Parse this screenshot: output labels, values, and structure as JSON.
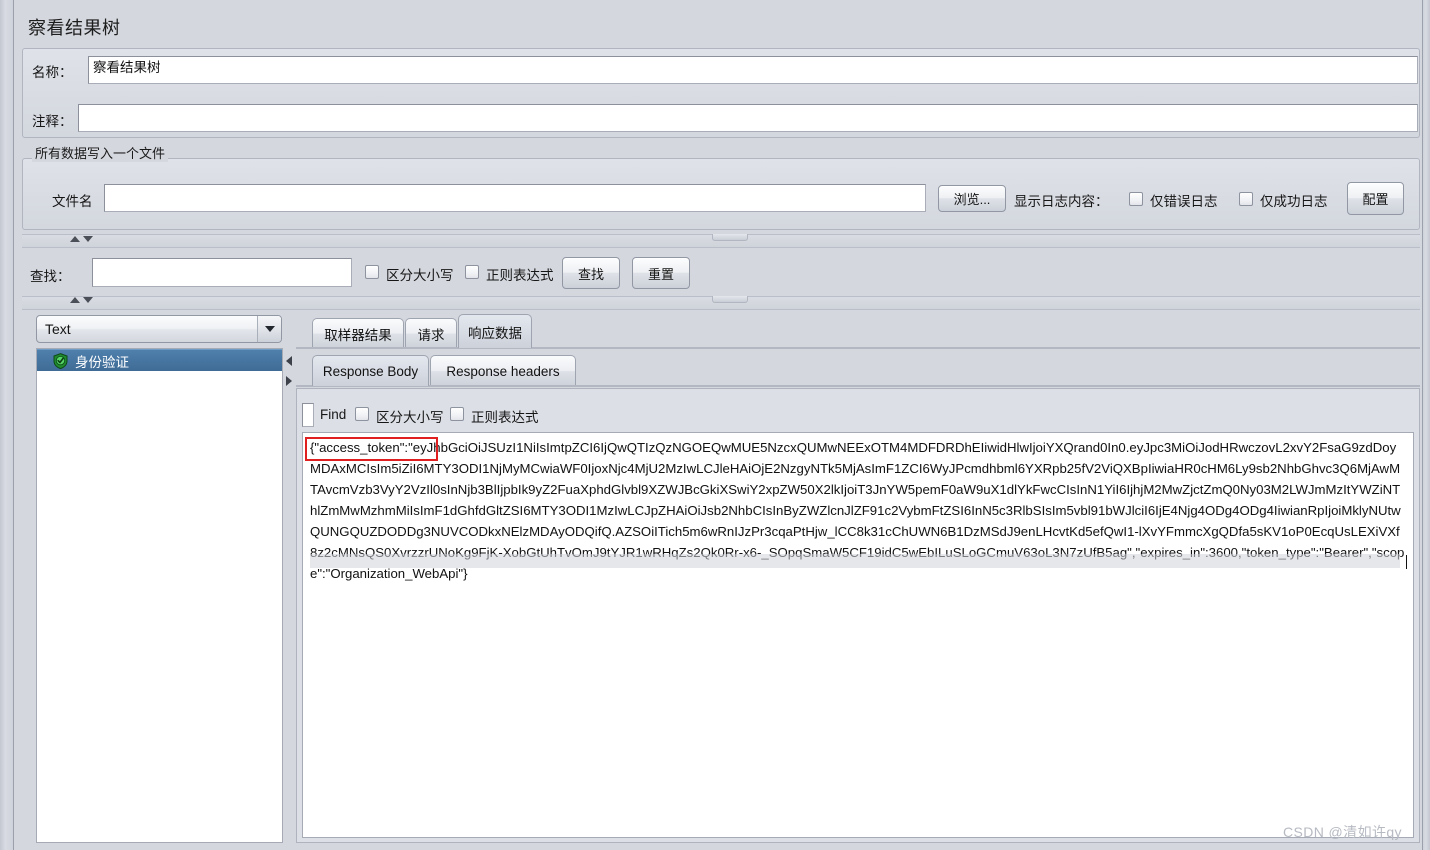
{
  "window": {
    "panel_title": "察看结果树"
  },
  "meta": {
    "name_label": "名称：",
    "name_value": "察看结果树",
    "comment_label": "注释：",
    "comment_value": ""
  },
  "file_group": {
    "legend": "所有数据写入一个文件",
    "filename_label": "文件名",
    "filename_value": "",
    "browse_button": "浏览...",
    "log_display_label": "显示日志内容：",
    "errors_only_label": "仅错误日志",
    "errors_only_checked": false,
    "success_only_label": "仅成功日志",
    "success_only_checked": false,
    "configure_button": "配置"
  },
  "search_bar": {
    "label": "查找：",
    "value": "",
    "case_sensitive_label": "区分大小写",
    "case_sensitive_checked": false,
    "regex_label": "正则表达式",
    "regex_checked": false,
    "find_button": "查找",
    "reset_button": "重置"
  },
  "left_panel": {
    "renderer_selected": "Text",
    "tree_items": [
      {
        "label": "身份验证",
        "status": "success",
        "icon": "shield-check-icon",
        "selected": true
      }
    ]
  },
  "result_tabs": {
    "items": [
      {
        "label": "取样器结果",
        "active": false
      },
      {
        "label": "请求",
        "active": false
      },
      {
        "label": "响应数据",
        "active": true
      }
    ]
  },
  "response_tabs": {
    "items": [
      {
        "label": "Response Body",
        "active": true
      },
      {
        "label": "Response headers",
        "active": false
      }
    ]
  },
  "response_find": {
    "label": "Find",
    "value": "",
    "case_sensitive_label": "区分大小写",
    "case_sensitive_checked": false,
    "regex_label": "正则表达式",
    "regex_checked": false
  },
  "response_body": {
    "highlight_text": "{\"access_token\":\"ey",
    "text": "{\"access_token\":\"eyJhbGciOiJSUzI1NiIsImtpZCI6IjQwQTIzQzNGOEQwMUE5NzcxQUMwNEExOTM4MDFDRDhEIiwidHlwIjoiYXQrand0In0.eyJpc3MiOiJodHRwczovL2xvY2FsaG9zdDoyMDAxMCIsIm5iZiI6MTY3ODI1NjMyMCwiaWF0IjoxNjc4MjU2MzIwLCJleHAiOjE2NzgyNTk5MjAsImF1ZCI6WyJPcmdhbml6YXRpb25fV2ViQXBpIiwiaHR0cHM6Ly9sb2NhbGhvc3Q6MjAwMTAvcmVzb3VyY2VzIl0sInNjb3BlIjpbIk9yZ2FuaXphdGlvbl9XZWJBcGkiXSwiY2xpZW50X2lkIjoiT3JnYW5pemF0aW9uX1dlYkFwcCIsInN1YiI6IjhjM2MwZjctZmQ0Ny03M2LWJmMzItYWZiNThlZmMwMzhmMiIsImF1dGhfdGltZSI6MTY3ODI1MzIwLCJpZHAiOiJsb2NhbCIsInByZWZlcnJlZF91c2VybmFtZSI6InN5c3RlbSIsIm5vbl91bWJlciI6IjE4Njg4ODg4ODg4IiwianRpIjoiMklyNUtwQUNGQUZDODDg3NUVCODkxNElzMDAyODQifQ.AZSOiITich5m6wRnIJzPr3cqaPtHjw_lCC8k31cChUWN6B1DzMSdJ9enLHcvtKd5efQwI1-lXvYFmmcXgQDfa5sKV1oP0EcqUsLEXiVXf8z2cMNsQS0XvrzzrUNoKg9FjK-XobGtUhTvOmJ9tYJR1wRHqZs2Qk0Rr-x6-_SOpqSmaW5CF19idC5wEbILuSLoGCmuV63oL3N7zUfB5ag\",\"expires_in\":3600,\"token_type\":\"Bearer\",\"scope\":\"Organization_WebApi\"}"
  },
  "watermark": {
    "text": "CSDN @清如许qy"
  },
  "colors": {
    "selection_blue": "#3f6c97",
    "highlight_red": "#e02020",
    "panel_bg": "#d4d7de",
    "field_bg": "#ffffff"
  }
}
